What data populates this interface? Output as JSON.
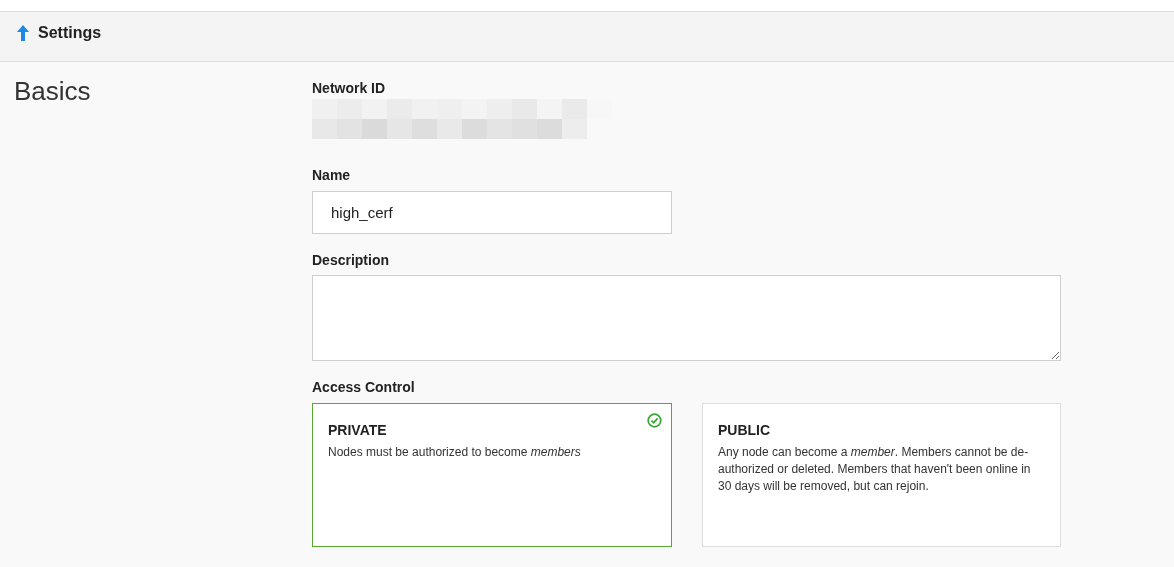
{
  "header": {
    "title": "Settings"
  },
  "section": {
    "title": "Basics"
  },
  "network_id": {
    "label": "Network ID"
  },
  "name": {
    "label": "Name",
    "value": "high_cerf"
  },
  "description": {
    "label": "Description"
  },
  "access_control": {
    "label": "Access Control",
    "options": [
      {
        "title": "PRIVATE",
        "text": "Nodes must be authorized to become *members*",
        "selected": true
      },
      {
        "title": "PUBLIC",
        "text": "Any node can become a *member*. Members cannot be de-authorized or deleted. Members that haven't been online in 30 days will be removed, but can rejoin.",
        "selected": false
      }
    ]
  }
}
